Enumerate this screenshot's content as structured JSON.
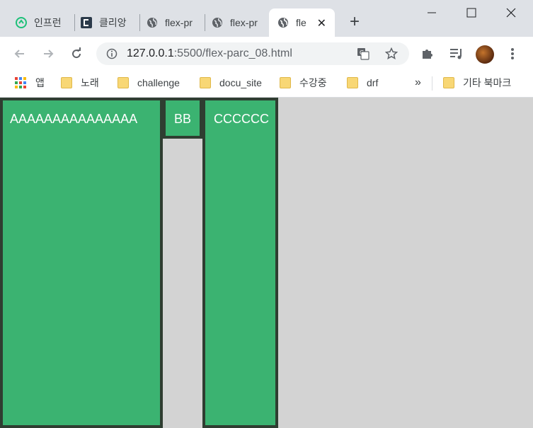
{
  "tabs": [
    {
      "label": "인프런",
      "icon": "inflearn-icon"
    },
    {
      "label": "클리앙",
      "icon": "clien-icon"
    },
    {
      "label": "flex-pr",
      "icon": "globe-icon"
    },
    {
      "label": "flex-pr",
      "icon": "globe-icon"
    },
    {
      "label": "fle",
      "icon": "globe-icon",
      "active": true
    }
  ],
  "address_bar": {
    "host": "127.0.0.1",
    "rest": ":5500/flex-parc_08.html"
  },
  "bookmarks": [
    {
      "label": "앱",
      "icon": "apps-grid-icon"
    },
    {
      "label": "노래",
      "icon": "folder-icon"
    },
    {
      "label": "challenge",
      "icon": "folder-icon"
    },
    {
      "label": "docu_site",
      "icon": "folder-icon"
    },
    {
      "label": "수강중",
      "icon": "folder-icon"
    },
    {
      "label": "drf",
      "icon": "folder-icon"
    },
    {
      "label": "»",
      "icon": ""
    },
    {
      "label": "기타 북마크",
      "icon": "folder-icon"
    }
  ],
  "content": {
    "items": [
      "AAAAAAAAAAAAAAA",
      "BB",
      "CCCCCC"
    ]
  },
  "colors": {
    "item_bg": "#3bb371",
    "item_border": "#2f3d31",
    "page_bg": "#d3d3d3"
  }
}
